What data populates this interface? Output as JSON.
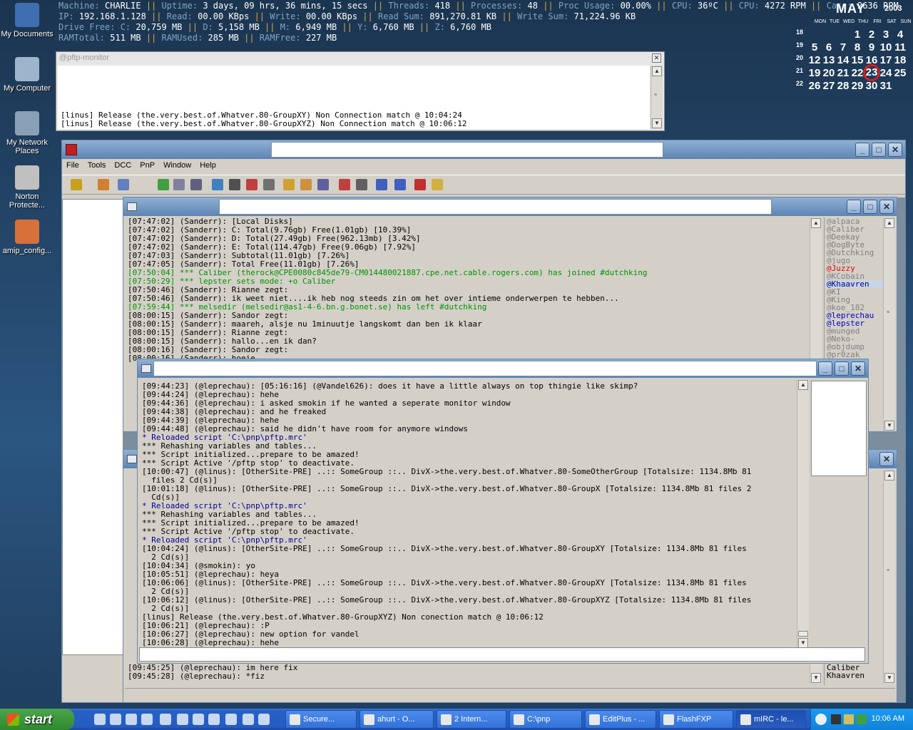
{
  "stats": {
    "line1": [
      {
        "k": "Machine: ",
        "v": "CHARLIE"
      },
      {
        "k": "Uptime: ",
        "v": "3 days, 09 hrs, 36 mins, 15 secs"
      },
      {
        "k": "Threads: ",
        "v": "418"
      },
      {
        "k": "Processes: ",
        "v": "48"
      },
      {
        "k": "Proc Usage: ",
        "v": "00.00%"
      },
      {
        "k": "CPU: ",
        "v": "36ºC"
      },
      {
        "k": "CPU: ",
        "v": "4272 RPM"
      },
      {
        "k": "Case: ",
        "v": "2636 RPM"
      }
    ],
    "line2": [
      {
        "k": "IP: ",
        "v": "192.168.1.128"
      },
      {
        "k": "Read: ",
        "v": "00.00 KBps"
      },
      {
        "k": "Write: ",
        "v": "00.00 KBps"
      },
      {
        "k": "Read Sum: ",
        "v": "891,270.81 KB"
      },
      {
        "k": "Write Sum: ",
        "v": "71,224.96 KB"
      }
    ],
    "line3": [
      {
        "k": "Drive Free: C: ",
        "v": "20,759 MB"
      },
      {
        "k": "D: ",
        "v": "5,158 MB"
      },
      {
        "k": "M: ",
        "v": "6,949 MB"
      },
      {
        "k": "Y: ",
        "v": "6,760 MB"
      },
      {
        "k": "Z: ",
        "v": "6,760 MB"
      }
    ],
    "line4": [
      {
        "k": "RAMTotal: ",
        "v": "511 MB"
      },
      {
        "k": "RAMUsed: ",
        "v": "285 MB"
      },
      {
        "k": "RAMFree: ",
        "v": "227 MB"
      }
    ],
    "separator": " || "
  },
  "calendar": {
    "month": "MAY",
    "year": "2003",
    "weekdays": [
      "MON",
      "TUE",
      "WED",
      "THU",
      "FRI",
      "SAT",
      "SUN"
    ],
    "weeks": [
      {
        "wk": "18",
        "days": [
          "",
          "",
          "",
          "1",
          "2",
          "3",
          "4"
        ]
      },
      {
        "wk": "19",
        "days": [
          "5",
          "6",
          "7",
          "8",
          "9",
          "10",
          "11"
        ]
      },
      {
        "wk": "20",
        "days": [
          "12",
          "13",
          "14",
          "15",
          "16",
          "17",
          "18"
        ]
      },
      {
        "wk": "21",
        "days": [
          "19",
          "20",
          "21",
          "22",
          "23",
          "24",
          "25"
        ]
      },
      {
        "wk": "22",
        "days": [
          "26",
          "27",
          "28",
          "29",
          "30",
          "31",
          ""
        ]
      }
    ],
    "today": "23"
  },
  "desktop_icons": [
    {
      "label": "My Documents",
      "icon": "documents-icon",
      "color": "#3f6fb0"
    },
    {
      "label": "My Computer",
      "icon": "computer-icon",
      "color": "#9cb4cc"
    },
    {
      "label": "My Network Places",
      "icon": "network-icon",
      "color": "#8aa0b8"
    },
    {
      "label": "Norton Protecte...",
      "icon": "recycle-bin-icon",
      "color": "#c0c0c0"
    },
    {
      "label": "amip_config...",
      "icon": "config-file-icon",
      "color": "#d8703a"
    }
  ],
  "pftp": {
    "title": "@pftp-monitor",
    "lines": [
      "[linus] Release (the.very.best.of.Whatver.80-GroupXY) Non Connection match @ 10:04:24",
      "[linus] Release (the.very.best.of.Whatver.80-GroupXYZ) Non Connection match @ 10:06:12"
    ]
  },
  "mirc": {
    "menu": [
      "File",
      "Tools",
      "DCC",
      "PnP",
      "Window",
      "Help"
    ]
  },
  "channel1": {
    "lines": [
      {
        "t": "[07:47:02] (Sanderr): [Local Disks]",
        "c": "#000000"
      },
      {
        "t": "[07:47:02] (Sanderr): C: Total(9.76gb) Free(1.01gb) [10.39%]",
        "c": "#000000"
      },
      {
        "t": "[07:47:02] (Sanderr): D: Total(27.49gb) Free(962.13mb) [3.42%]",
        "c": "#000000"
      },
      {
        "t": "[07:47:02] (Sanderr): E: Total(114.47gb) Free(9.06gb) [7.92%]",
        "c": "#000000"
      },
      {
        "t": "[07:47:03] (Sanderr): Subtotal(11.01gb) [7.26%]",
        "c": "#000000"
      },
      {
        "t": "[07:47:05] (Sanderr): Total Free(11.01gb) [7.26%]",
        "c": "#000000"
      },
      {
        "t": "[07:50:04] *** Caliber (therock@CPE0080c845de79-CM014480021887.cpe.net.cable.rogers.com) has joined #dutchking",
        "c": "#009300"
      },
      {
        "t": "[07:50:29] *** lepster sets mode: +o Caliber",
        "c": "#009300"
      },
      {
        "t": "[07:50:46] (Sanderr): Rianne zegt:",
        "c": "#000000"
      },
      {
        "t": "[07:50:46] (Sanderr): ik weet niet....ik heb nog steeds zin om het over intieme onderwerpen te hebben...",
        "c": "#000000"
      },
      {
        "t": "[07:59:44] *** melsedir (melsedir@as1-4-6.bn.g.bonet.se) has left #dutchking",
        "c": "#009300"
      },
      {
        "t": "[08:00:15] (Sanderr): Sandor zegt:",
        "c": "#000000"
      },
      {
        "t": "[08:00:15] (Sanderr): maareh, alsje nu 1minuutje langskomt dan ben ik klaar",
        "c": "#000000"
      },
      {
        "t": "[08:00:15] (Sanderr): Rianne zegt:",
        "c": "#000000"
      },
      {
        "t": "[08:00:15] (Sanderr): hallo...en ik dan?",
        "c": "#000000"
      },
      {
        "t": "[08:00:16] (Sanderr): Sandor zegt:",
        "c": "#000000"
      },
      {
        "t": "[08:00:16] (Sanderr): hoeie",
        "c": "#000000"
      }
    ],
    "nicks": [
      {
        "n": "@alpaca",
        "c": "#808080"
      },
      {
        "n": "@Caliber",
        "c": "#808080"
      },
      {
        "n": "@Deekay",
        "c": "#808080"
      },
      {
        "n": "@DogByte",
        "c": "#808080"
      },
      {
        "n": "@Dutchking",
        "c": "#808080"
      },
      {
        "n": "@jugo",
        "c": "#808080"
      },
      {
        "n": "@Juzzy",
        "c": "#e00000"
      },
      {
        "n": "@KCobain",
        "c": "#808080"
      },
      {
        "n": "@Khaavren",
        "c": "#000080",
        "sel": true
      },
      {
        "n": "@KI",
        "c": "#808080"
      },
      {
        "n": "@King",
        "c": "#808080"
      },
      {
        "n": "@koe_182",
        "c": "#808080"
      },
      {
        "n": "@leprechau",
        "c": "#0000c0"
      },
      {
        "n": "@lepster",
        "c": "#0000c0"
      },
      {
        "n": "@munged",
        "c": "#808080"
      },
      {
        "n": "@Neko-",
        "c": "#808080"
      },
      {
        "n": "@objdump",
        "c": "#808080"
      },
      {
        "n": "@pr0zak",
        "c": "#808080"
      }
    ]
  },
  "channel3": {
    "lines": [
      {
        "t": "[09:45:25] (@leprechau): im here fix",
        "c": "#000000"
      },
      {
        "t": "[09:45:28] (@leprechau): *fiz",
        "c": "#000000"
      }
    ],
    "nicks": [
      {
        "n": "Caliber",
        "c": "#000000"
      },
      {
        "n": "Khaavren",
        "c": "#000000"
      }
    ]
  },
  "channel2": {
    "lines": [
      {
        "t": "[09:44:23] (@leprechau): [05:16:16] (@Vandel626): does it have a little always on top thingie like skimp?",
        "c": "#000000"
      },
      {
        "t": "[09:44:24] (@leprechau): hehe",
        "c": "#000000"
      },
      {
        "t": "[09:44:36] (@leprechau): i asked smokin if he wanted a seperate monitor window",
        "c": "#000000"
      },
      {
        "t": "[09:44:38] (@leprechau): and he freaked",
        "c": "#000000"
      },
      {
        "t": "[09:44:39] (@leprechau): hehe",
        "c": "#000000"
      },
      {
        "t": "[09:44:48] (@leprechau): said he didn't have room for anymore windows",
        "c": "#000000"
      },
      {
        "t": "* Reloaded script 'C:\\pnp\\pftp.mrc'",
        "c": "#000090"
      },
      {
        "t": "*** Rehashing variables and tables...",
        "c": "#000000"
      },
      {
        "t": "*** Script initialized...prepare to be amazed!",
        "c": "#000000"
      },
      {
        "t": "*** Script Active '/pftp stop' to deactivate.",
        "c": "#000000"
      },
      {
        "t": "[10:00:47] (@linus): [OtherSite-PRE] ..:: SomeGroup ::.. DivX->the.very.best.of.Whatver.80-SomeOtherGroup [Totalsize: 1134.8Mb 81",
        "c": "#000000"
      },
      {
        "t": "  files 2 Cd(s)]",
        "c": "#000000"
      },
      {
        "t": "[10:01:18] (@linus): [OtherSite-PRE] ..:: SomeGroup ::.. DivX->the.very.best.of.Whatver.80-GroupX [Totalsize: 1134.8Mb 81 files 2",
        "c": "#000000"
      },
      {
        "t": "  Cd(s)]",
        "c": "#000000"
      },
      {
        "t": "* Reloaded script 'C:\\pnp\\pftp.mrc'",
        "c": "#000090"
      },
      {
        "t": "*** Rehashing variables and tables...",
        "c": "#000000"
      },
      {
        "t": "*** Script initialized...prepare to be amazed!",
        "c": "#000000"
      },
      {
        "t": "*** Script Active '/pftp stop' to deactivate.",
        "c": "#000000"
      },
      {
        "t": "* Reloaded script 'C:\\pnp\\pftp.mrc'",
        "c": "#000090"
      },
      {
        "t": "[10:04:24] (@linus): [OtherSite-PRE] ..:: SomeGroup ::.. DivX->the.very.best.of.Whatver.80-GroupXY [Totalsize: 1134.8Mb 81 files",
        "c": "#000000"
      },
      {
        "t": "  2 Cd(s)]",
        "c": "#000000"
      },
      {
        "t": "[10:04:34] (@smokin): yo",
        "c": "#000000"
      },
      {
        "t": "[10:05:51] (@leprechau): heya",
        "c": "#000000"
      },
      {
        "t": "[10:06:06] (@linus): [OtherSite-PRE] ..:: SomeGroup ::.. DivX->the.very.best.of.Whatver.80-GroupXY [Totalsize: 1134.8Mb 81 files",
        "c": "#000000"
      },
      {
        "t": "  2 Cd(s)]",
        "c": "#000000"
      },
      {
        "t": "[10:06:12] (@linus): [OtherSite-PRE] ..:: SomeGroup ::.. DivX->the.very.best.of.Whatver.80-GroupXYZ [Totalsize: 1134.8Mb 81 files",
        "c": "#000000"
      },
      {
        "t": "  2 Cd(s)]",
        "c": "#000000"
      },
      {
        "t": "[linus] Release (the.very.best.of.Whatver.80-GroupXYZ) Non conection match @ 10:06:12",
        "c": "#000000"
      },
      {
        "t": "[10:06:21] (@leprechau): :P",
        "c": "#000000"
      },
      {
        "t": "[10:06:27] (@leprechau): new option for vandel",
        "c": "#000000"
      },
      {
        "t": "[10:06:28] (@leprechau): hehe",
        "c": "#000000"
      }
    ],
    "input_value": ""
  },
  "taskbar": {
    "start_label": "start",
    "tasks": [
      {
        "label": "Secure...",
        "icon": "terminal-icon"
      },
      {
        "label": "ahurt - O...",
        "icon": "mail-icon"
      },
      {
        "label": "2 Intern...",
        "icon": "ie-icon"
      },
      {
        "label": "C:\\pnp",
        "icon": "folder-icon"
      },
      {
        "label": "EditPlus - ...",
        "icon": "editor-icon"
      },
      {
        "label": "FlashFXP",
        "icon": "ftp-icon"
      },
      {
        "label": "mIRC - le...",
        "icon": "mirc-icon",
        "active": true
      }
    ],
    "clock": "10:06 AM"
  }
}
